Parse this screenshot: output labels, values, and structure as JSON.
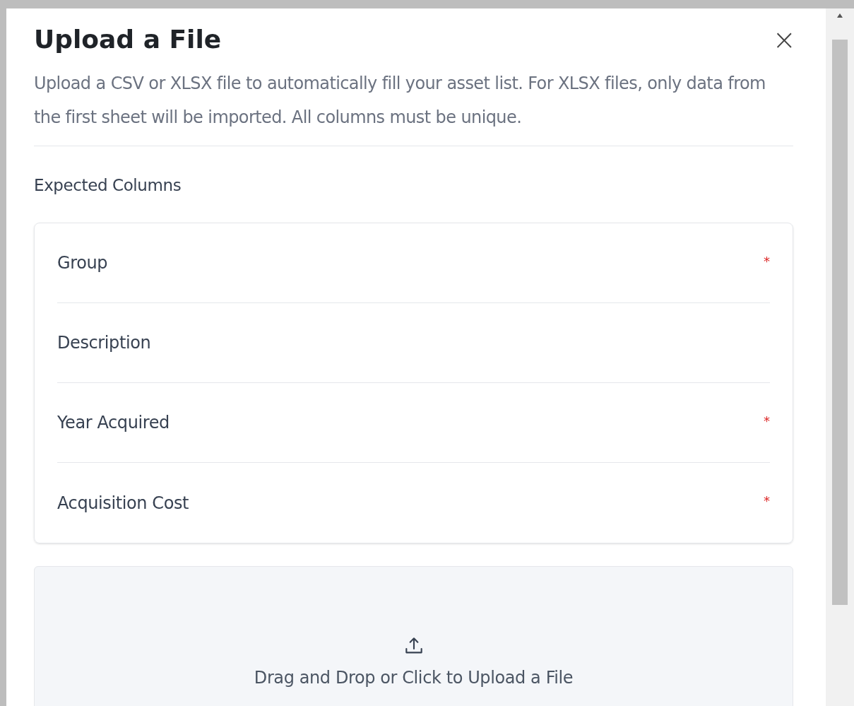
{
  "dialog": {
    "title": "Upload a File",
    "close_icon": "×",
    "description": "Upload a CSV or XLSX file to automatically fill your asset list. For XLSX files, only data from the first sheet will be imported. All columns must be unique.",
    "section_label": "Expected Columns",
    "columns": [
      {
        "label": "Group",
        "required_mark": "*"
      },
      {
        "label": "Description"
      },
      {
        "label": "Year Acquired",
        "required_mark": "*"
      },
      {
        "label": "Acquisition Cost",
        "required_mark": "*"
      }
    ],
    "dropzone": {
      "label": "Drag and Drop or Click to Upload a File"
    }
  }
}
